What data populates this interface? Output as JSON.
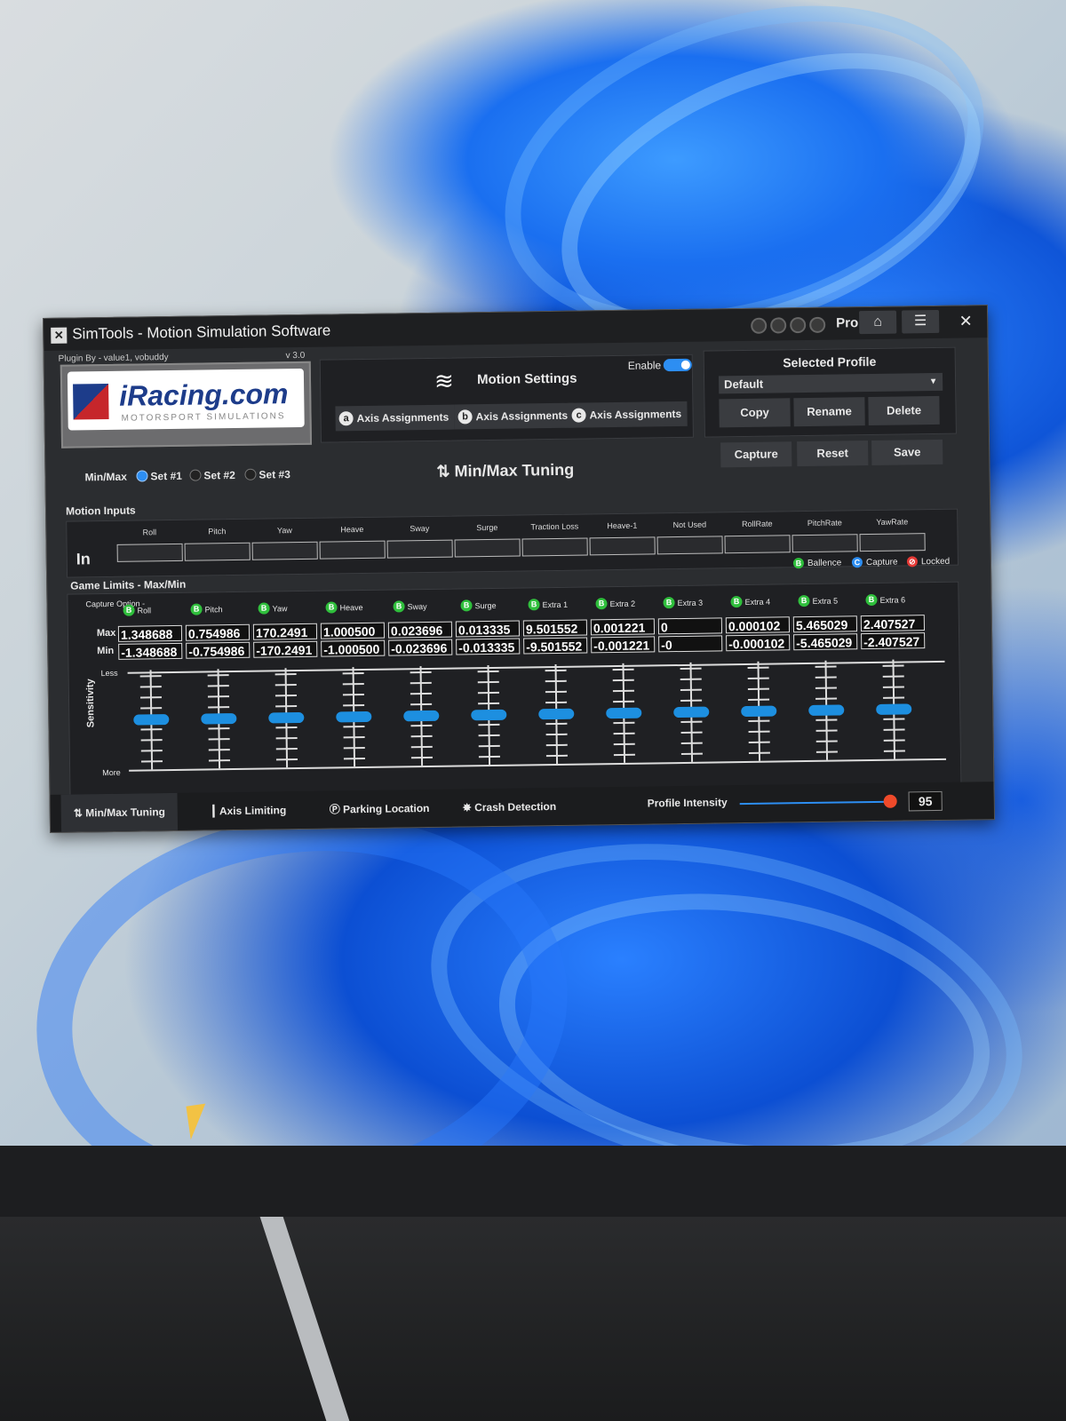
{
  "colors": {
    "accent": "#2d8ef2",
    "balance": "#2fbf3c",
    "capture": "#2d8ef2",
    "locked": "#e53935",
    "thumb": "#1d8fe0",
    "intensity_thumb": "#ef4a2a"
  },
  "window": {
    "title": "SimTools - Motion Simulation Software",
    "plan": "Pro",
    "icons": {
      "home": "home-icon",
      "menu": "hamburger-menu-icon",
      "close": "close-icon"
    }
  },
  "plugin": {
    "by": "Plugin By - value1, vobuddy",
    "version": "v 3.0",
    "banner_title": "iRacing.com",
    "banner_sub": "MOTORSPORT SIMULATIONS"
  },
  "motion_settings": {
    "title": "Motion Settings",
    "enable_label": "Enable",
    "enabled": true,
    "axis_buttons": [
      {
        "badge": "a",
        "label": "Axis Assignments"
      },
      {
        "badge": "b",
        "label": "Axis Assignments"
      },
      {
        "badge": "c",
        "label": "Axis Assignments"
      }
    ]
  },
  "profile": {
    "title": "Selected Profile",
    "selected": "Default",
    "buttons": {
      "copy": "Copy",
      "rename": "Rename",
      "delete": "Delete"
    }
  },
  "tuning": {
    "minmax_label": "Min/Max",
    "sets": [
      "Set #1",
      "Set #2",
      "Set #3"
    ],
    "selected_set": "Set #1",
    "title": "Min/Max Tuning",
    "buttons": {
      "capture": "Capture",
      "reset": "Reset",
      "save": "Save"
    }
  },
  "motion_inputs": {
    "label": "Motion Inputs",
    "row_label": "In",
    "columns": [
      "Roll",
      "Pitch",
      "Yaw",
      "Heave",
      "Sway",
      "Surge",
      "Traction Loss",
      "Heave-1",
      "Not Used",
      "RollRate",
      "PitchRate",
      "YawRate"
    ]
  },
  "game_limits": {
    "label": "Game Limits - Max/Min",
    "capture_option": "Capture Option -",
    "legend": [
      {
        "badge": "B",
        "label": "Ballence"
      },
      {
        "badge": "C",
        "label": "Capture"
      },
      {
        "badge": "⊘",
        "label": "Locked"
      }
    ],
    "max_label": "Max",
    "min_label": "Min",
    "columns": [
      {
        "name": "Roll",
        "option": "B",
        "max": "1.348688",
        "min": "-1.348688",
        "sensitivity": 0.5
      },
      {
        "name": "Pitch",
        "option": "B",
        "max": "0.754986",
        "min": "-0.754986",
        "sensitivity": 0.5
      },
      {
        "name": "Yaw",
        "option": "B",
        "max": "170.2491",
        "min": "-170.2491",
        "sensitivity": 0.5
      },
      {
        "name": "Heave",
        "option": "B",
        "max": "1.000500",
        "min": "-1.000500",
        "sensitivity": 0.5
      },
      {
        "name": "Sway",
        "option": "B",
        "max": "0.023696",
        "min": "-0.023696",
        "sensitivity": 0.5
      },
      {
        "name": "Surge",
        "option": "B",
        "max": "0.013335",
        "min": "-0.013335",
        "sensitivity": 0.5
      },
      {
        "name": "Extra 1",
        "option": "B",
        "max": "9.501552",
        "min": "-9.501552",
        "sensitivity": 0.5
      },
      {
        "name": "Extra 2",
        "option": "B",
        "max": "0.001221",
        "min": "-0.001221",
        "sensitivity": 0.5
      },
      {
        "name": "Extra 3",
        "option": "B",
        "max": "0",
        "min": "-0",
        "sensitivity": 0.5
      },
      {
        "name": "Extra 4",
        "option": "B",
        "max": "0.000102",
        "min": "-0.000102",
        "sensitivity": 0.5
      },
      {
        "name": "Extra 5",
        "option": "B",
        "max": "5.465029",
        "min": "-5.465029",
        "sensitivity": 0.5
      },
      {
        "name": "Extra 6",
        "option": "B",
        "max": "2.407527",
        "min": "-2.407527",
        "sensitivity": 0.5
      }
    ],
    "less_label": "Less",
    "more_label": "More",
    "sensitivity_label": "Sensitivity"
  },
  "bottom": {
    "tabs": [
      {
        "icon": "up-down-arrows-icon",
        "glyph": "⇅",
        "label": "Min/Max Tuning",
        "active": true
      },
      {
        "icon": "axis-limit-icon",
        "glyph": "┃",
        "label": "Axis Limiting",
        "active": false
      },
      {
        "icon": "parking-icon",
        "glyph": "Ⓟ",
        "label": "Parking Location",
        "active": false
      },
      {
        "icon": "crash-icon",
        "glyph": "✸",
        "label": "Crash Detection",
        "active": false
      }
    ],
    "intensity_label": "Profile Intensity",
    "intensity_value": "95"
  }
}
